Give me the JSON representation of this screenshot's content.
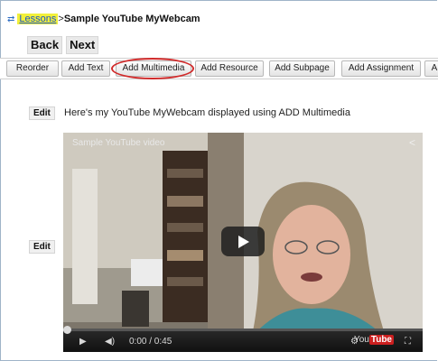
{
  "breadcrumb": {
    "link": "Lessons",
    "separator": ">",
    "title": "Sample YouTube MyWebcam"
  },
  "nav": {
    "back": "Back",
    "next": "Next"
  },
  "toolbar": [
    "Reorder",
    "Add Text",
    "Add Multimedia",
    "Add Resource",
    "Add Subpage",
    "Add Assignment",
    "A"
  ],
  "items": [
    {
      "edit": "Edit",
      "text": "Here's my YouTube MyWebcam displayed using ADD Multimedia"
    },
    {
      "edit": "Edit"
    }
  ],
  "video": {
    "title": "Sample YouTube video",
    "time": "0:00 / 0:45"
  },
  "colors": {
    "highlight": "#f2f03a",
    "link": "#1a55c9",
    "annotation_ring": "#d12b2b"
  }
}
